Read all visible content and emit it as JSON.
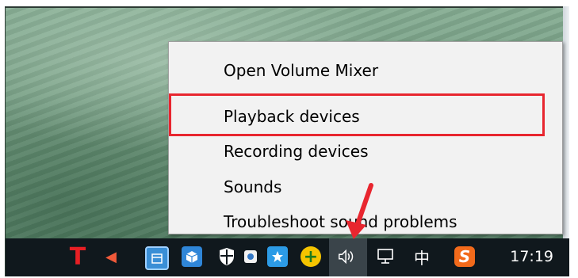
{
  "menu": {
    "items": [
      {
        "label": "Open Volume Mixer"
      },
      {
        "label": "Playback devices"
      },
      {
        "label": "Recording devices"
      },
      {
        "label": "Sounds"
      },
      {
        "label": "Troubleshoot sound problems"
      }
    ]
  },
  "taskbar": {
    "icons": [
      {
        "name": "t-app-icon",
        "glyph": "T"
      },
      {
        "name": "speaker-red-icon",
        "glyph": "◀"
      },
      {
        "name": "calendar-app-icon",
        "glyph": ""
      },
      {
        "name": "package-app-icon",
        "glyph": ""
      },
      {
        "name": "shield-app-icon",
        "glyph": ""
      },
      {
        "name": "puzzle-app-icon",
        "glyph": ""
      },
      {
        "name": "star-app-icon",
        "glyph": ""
      },
      {
        "name": "plus-app-icon",
        "glyph": "+"
      },
      {
        "name": "volume-icon",
        "glyph": "🔈"
      },
      {
        "name": "network-icon",
        "glyph": ""
      },
      {
        "name": "ime-icon",
        "glyph": "中"
      },
      {
        "name": "sogou-icon",
        "glyph": "S"
      }
    ],
    "clock": "17:19"
  },
  "colors": {
    "highlight": "#e8262f",
    "arrow": "#e8262f",
    "taskbar": "#10181d",
    "menu": "#f2f2f2"
  }
}
